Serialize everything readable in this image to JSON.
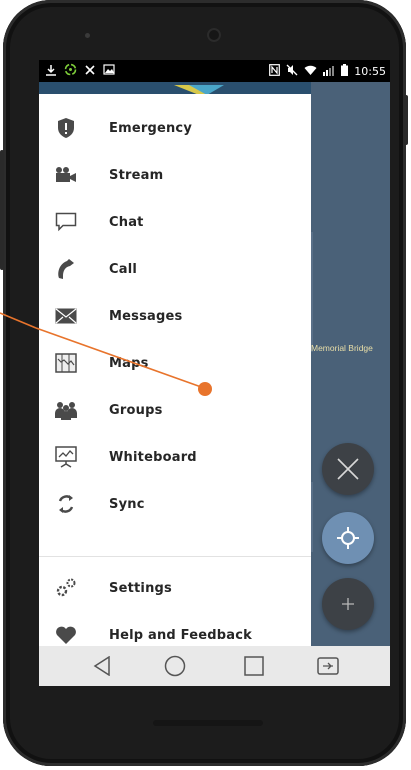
{
  "statusbar": {
    "time": "10:55",
    "left_icons": [
      "download-icon",
      "sync-icon",
      "scissors-icon",
      "image-icon"
    ],
    "right_icons": [
      "nfc-icon",
      "mute-icon",
      "wifi-icon",
      "signal-icon",
      "battery-icon"
    ]
  },
  "drawer": {
    "items": [
      {
        "label": "Emergency",
        "icon": "shield-icon"
      },
      {
        "label": "Stream",
        "icon": "video-camera-icon"
      },
      {
        "label": "Chat",
        "icon": "chat-bubble-icon"
      },
      {
        "label": "Call",
        "icon": "phone-icon"
      },
      {
        "label": "Messages",
        "icon": "envelope-icon"
      },
      {
        "label": "Maps",
        "icon": "map-icon"
      },
      {
        "label": "Groups",
        "icon": "people-icon"
      },
      {
        "label": "Whiteboard",
        "icon": "whiteboard-icon"
      },
      {
        "label": "Sync",
        "icon": "sync-arrows-icon"
      }
    ],
    "footer_items": [
      {
        "label": "Settings",
        "icon": "gears-icon"
      },
      {
        "label": "Help and Feedback",
        "icon": "heart-icon"
      }
    ]
  },
  "map": {
    "label": "Memorial Bridge"
  },
  "fabs": [
    "close-icon",
    "location-target-icon",
    "plus-icon"
  ],
  "navbar": [
    "back-icon",
    "home-icon",
    "recents-icon",
    "screen-mirror-icon"
  ],
  "colors": {
    "drawer_bg": "#ffffff",
    "map_bg": "#4a6178",
    "annotation": "#e8742c",
    "nav_bg": "#e9e9e9",
    "text": "#262626"
  }
}
